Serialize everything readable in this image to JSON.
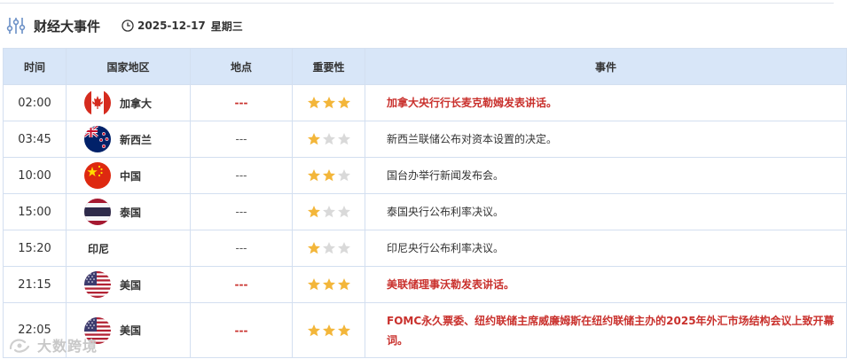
{
  "header": {
    "title": "财经大事件",
    "date": "2025-12-17",
    "weekday": "星期三"
  },
  "columns": {
    "time": "时间",
    "country": "国家地区",
    "place": "地点",
    "importance": "重要性",
    "event": "事件"
  },
  "colors": {
    "header_bg": "#d8e6f8",
    "highlight": "#c9302c",
    "star_on": "#f3b63a",
    "star_off": "#d9d9d9"
  },
  "rows": [
    {
      "time": "02:00",
      "country": "加拿大",
      "flag": "flag-canada",
      "place": "---",
      "importance": 3,
      "event": "加拿大央行行长麦克勒姆发表讲话。",
      "highlight": true
    },
    {
      "time": "03:45",
      "country": "新西兰",
      "flag": "flag-new-zealand",
      "place": "---",
      "importance": 1,
      "event": "新西兰联储公布对资本设置的决定。",
      "highlight": false
    },
    {
      "time": "10:00",
      "country": "中国",
      "flag": "flag-china",
      "place": "---",
      "importance": 2,
      "event": "国台办举行新闻发布会。",
      "highlight": false
    },
    {
      "time": "15:00",
      "country": "泰国",
      "flag": "flag-thailand",
      "place": "---",
      "importance": 1,
      "event": "泰国央行公布利率决议。",
      "highlight": false
    },
    {
      "time": "15:20",
      "country": "印尼",
      "flag": "",
      "place": "---",
      "importance": 1,
      "event": "印尼央行公布利率决议。",
      "highlight": false
    },
    {
      "time": "21:15",
      "country": "美国",
      "flag": "flag-usa",
      "place": "---",
      "importance": 3,
      "event": "美联储理事沃勒发表讲话。",
      "highlight": true
    },
    {
      "time": "22:05",
      "country": "美国",
      "flag": "flag-usa",
      "place": "---",
      "importance": 3,
      "event": "FOMC永久票委、纽约联储主席威廉姆斯在纽约联储主办的2025年外汇市场结构会议上致开幕词。",
      "highlight": true
    }
  ],
  "watermark": "大数跨境"
}
